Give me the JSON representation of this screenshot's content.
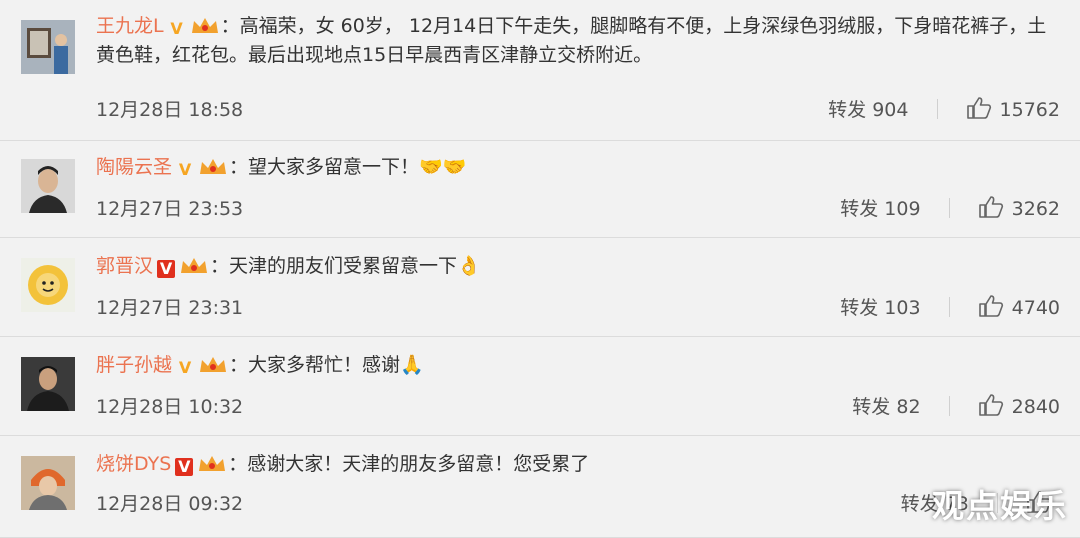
{
  "comments": [
    {
      "username": "王九龙L",
      "badge": "V",
      "badge_style": "gold",
      "text": "：高福荣，女 60岁， 12月14日下午走失，腿脚略有不便，上身深绿色羽绒服，下身暗花裤子，土黄色鞋，红花包。最后出现地点15日早晨西青区津静立交桥附近。",
      "time": "12月28日 18:58",
      "repost_label": "转发",
      "repost_count": "904",
      "like_count": "15762"
    },
    {
      "username": "陶陽云圣",
      "badge": "V",
      "badge_style": "gold",
      "text": "：望大家多留意一下！",
      "emoji": "🤝🤝",
      "time": "12月27日 23:53",
      "repost_label": "转发",
      "repost_count": "109",
      "like_count": "3262"
    },
    {
      "username": "郭晋汉",
      "badge": "V",
      "badge_style": "red",
      "text": "：天津的朋友们受累留意一下",
      "emoji": "👌",
      "time": "12月27日 23:31",
      "repost_label": "转发",
      "repost_count": "103",
      "like_count": "4740"
    },
    {
      "username": "胖子孙越",
      "badge": "V",
      "badge_style": "gold",
      "text": "：大家多帮忙！感谢",
      "emoji": "🙏",
      "time": "12月28日 10:32",
      "repost_label": "转发",
      "repost_count": "82",
      "like_count": "2840"
    },
    {
      "username": "烧饼DYS",
      "badge": "V",
      "badge_style": "red",
      "text": "：感谢大家！天津的朋友多留意！您受累了",
      "time": "12月28日 09:32",
      "repost_label": "转发",
      "repost_count": "73",
      "like_count": ""
    }
  ],
  "watermark": "观点娱乐",
  "colors": {
    "username": "#eb7350",
    "gold_v": "#f6a623",
    "red_v": "#e0301e",
    "crown": "#f2a12e"
  }
}
